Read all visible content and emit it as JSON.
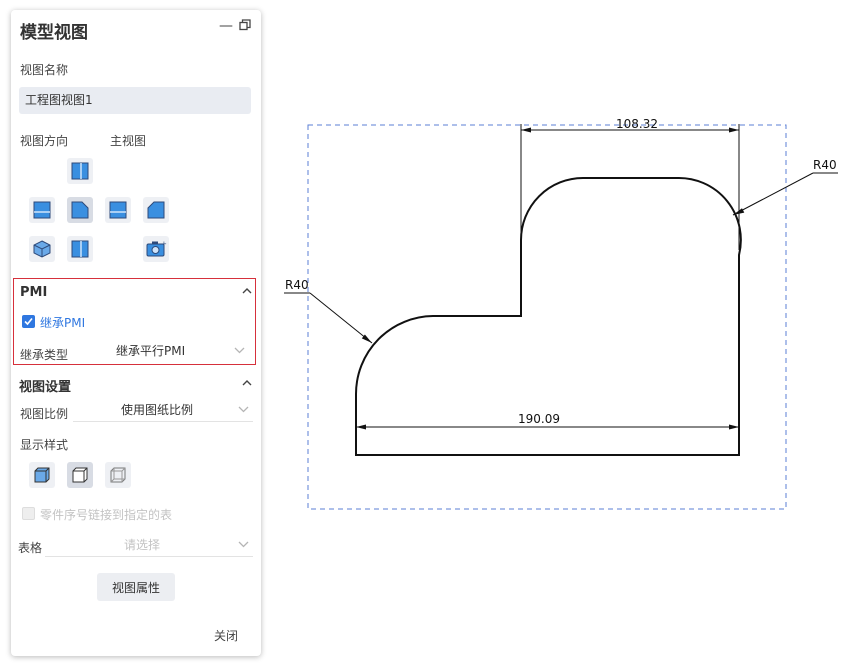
{
  "panel": {
    "title": "模型视图",
    "view_name_label": "视图名称",
    "view_name_value": "工程图视图1",
    "view_direction_label": "视图方向",
    "view_direction_value": "主视图",
    "pmi": {
      "section_title": "PMI",
      "inherit_label": "继承PMI",
      "inherit_checked": true,
      "inherit_type_label": "继承类型",
      "inherit_type_value": "继承平行PMI"
    },
    "view_settings": {
      "section_title": "视图设置",
      "scale_label": "视图比例",
      "scale_value": "使用图纸比例",
      "display_style_label": "显示样式",
      "link_label": "零件序号链接到指定的表",
      "table_label": "表格",
      "table_placeholder": "请选择"
    },
    "properties_button": "视图属性",
    "close_button": "关闭"
  },
  "drawing": {
    "dim_top_width": "108.32",
    "dim_bottom_width": "190.09",
    "radius_left": "R40",
    "radius_right": "R40"
  },
  "colors": {
    "accent": "#2f77e0",
    "highlight_border": "#d6303b",
    "frame_dashed": "#5b7fd6"
  }
}
